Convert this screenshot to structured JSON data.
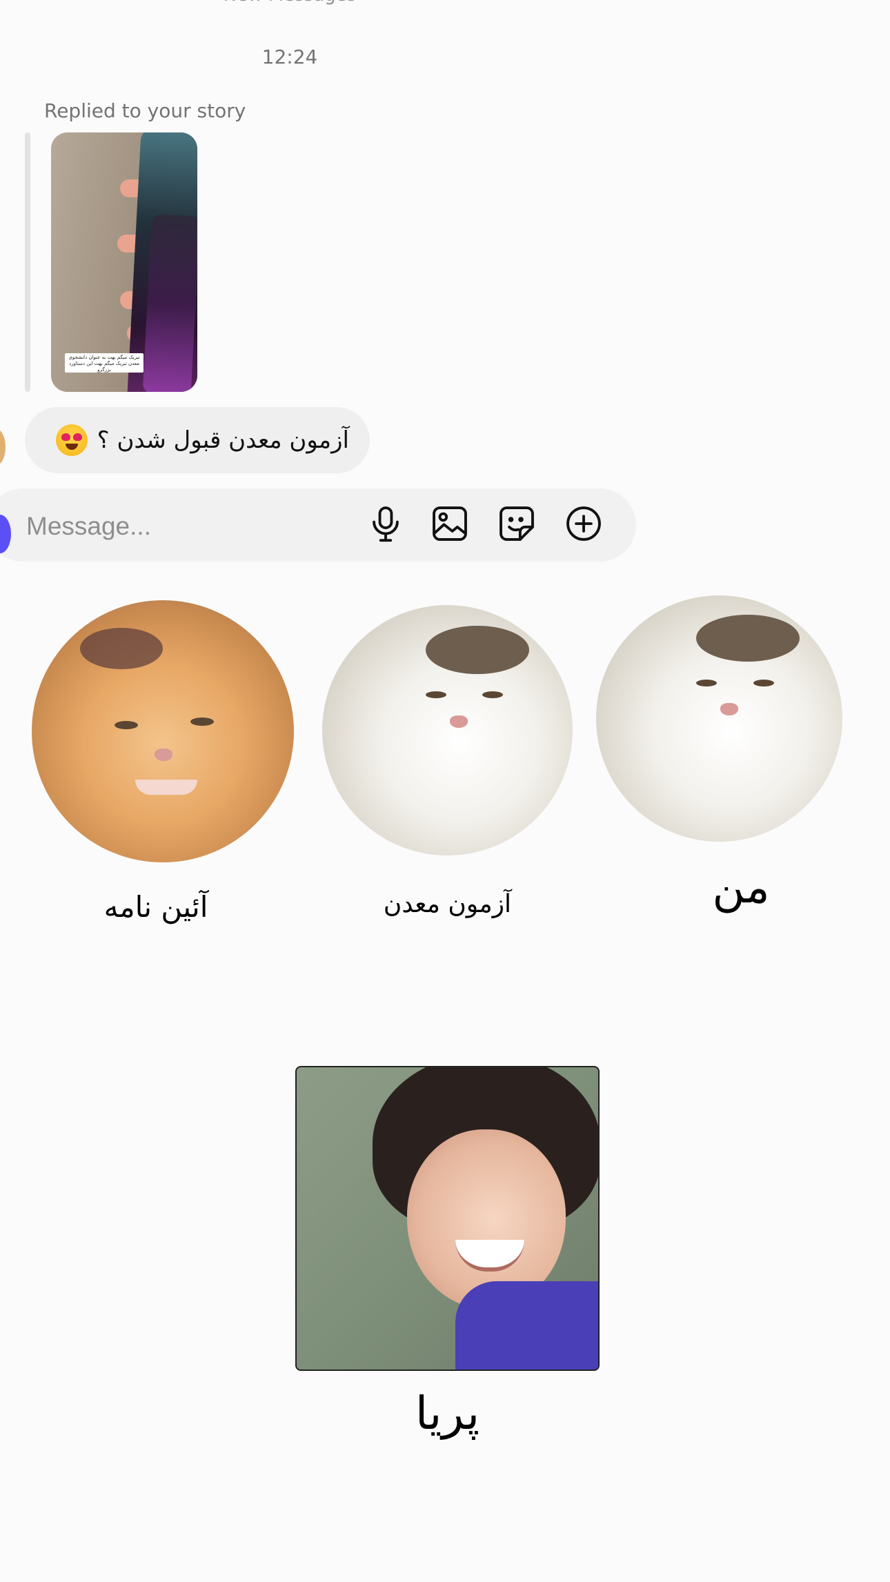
{
  "chat": {
    "new_messages_label": "New Messages",
    "timestamp": "12:24",
    "reply_label": "Replied to your story",
    "story_caption": "تبریک میگم بهت به عنوان دانشجوی معدن تبریک میگم بهت این دستاورد بزرگرو",
    "message_text": "آزمون معدن قبول شدن ؟",
    "message_emoji": "heart-eyes-emoji"
  },
  "composer": {
    "placeholder": "Message...",
    "icons": [
      "microphone-icon",
      "gallery-icon",
      "sticker-icon",
      "plus-icon"
    ]
  },
  "stickers": {
    "circles": [
      {
        "label": "آئین نامه",
        "image": "orange-cat"
      },
      {
        "label": "آزمون معدن",
        "image": "white-cat"
      },
      {
        "label": "من",
        "image": "white-cat"
      }
    ],
    "square": {
      "label": "پریا",
      "image": "smiling-girl"
    }
  },
  "colors": {
    "background": "#fbfbfb",
    "bubble": "#efefef",
    "composer": "#f1f1f1",
    "camera_button": "#5b4ff5",
    "muted_text": "#737373"
  }
}
